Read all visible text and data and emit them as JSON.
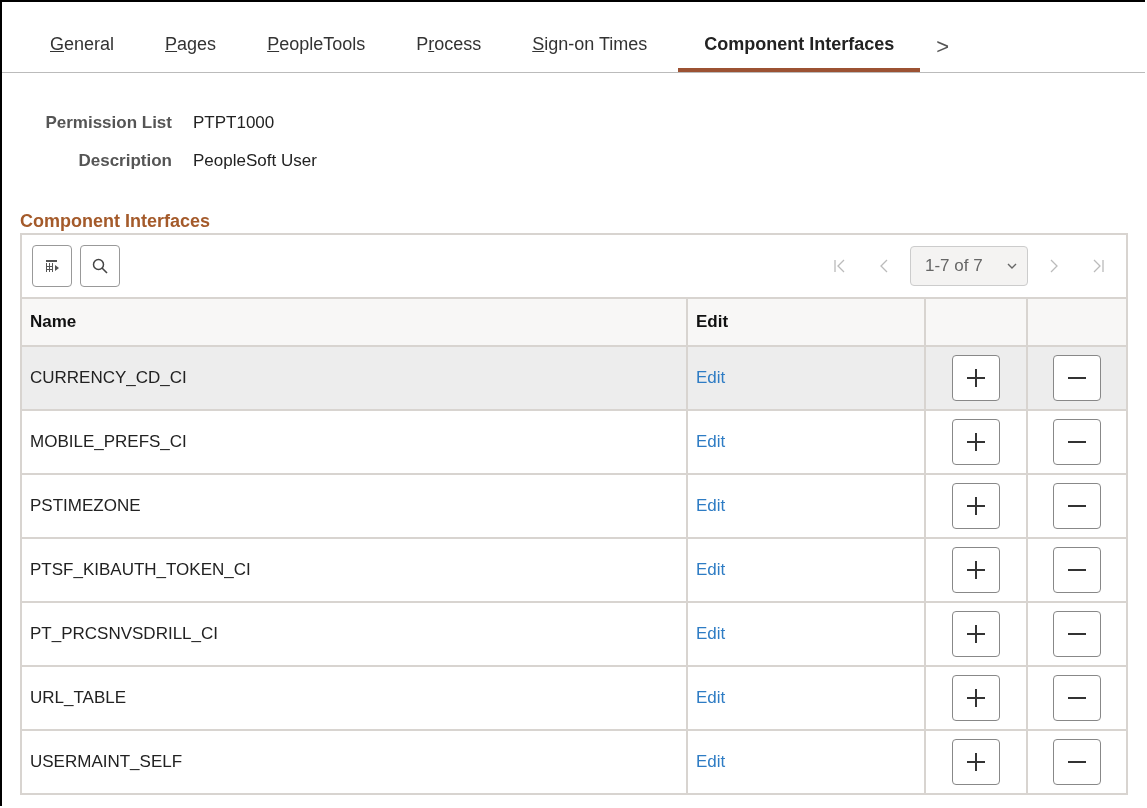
{
  "tabs": [
    {
      "key": "G",
      "post": "eneral",
      "selected": false
    },
    {
      "key": "P",
      "post": "ages",
      "selected": false
    },
    {
      "key": "P",
      "post": "eopleTools",
      "selected": false
    },
    {
      "pre": "P",
      "key": "r",
      "post": "ocess",
      "selected": false
    },
    {
      "key": "S",
      "post": "ign-on Times",
      "selected": false
    },
    {
      "pre": "Component Interfaces",
      "selected": true
    }
  ],
  "tabs_more": ">",
  "fields": [
    {
      "label": "Permission List",
      "value": "PTPT1000"
    },
    {
      "label": "Description",
      "value": "PeopleSoft User"
    }
  ],
  "section_title": "Component Interfaces",
  "grid": {
    "pager": "1-7 of 7",
    "columns": [
      "Name",
      "Edit"
    ],
    "rows": [
      {
        "name": "CURRENCY_CD_CI",
        "edit": "Edit",
        "selected": true
      },
      {
        "name": "MOBILE_PREFS_CI",
        "edit": "Edit",
        "selected": false
      },
      {
        "name": "PSTIMEZONE",
        "edit": "Edit",
        "selected": false
      },
      {
        "name": "PTSF_KIBAUTH_TOKEN_CI",
        "edit": "Edit",
        "selected": false
      },
      {
        "name": "PT_PRCSNVSDRILL_CI",
        "edit": "Edit",
        "selected": false
      },
      {
        "name": "URL_TABLE",
        "edit": "Edit",
        "selected": false
      },
      {
        "name": "USERMAINT_SELF",
        "edit": "Edit",
        "selected": false
      }
    ]
  }
}
